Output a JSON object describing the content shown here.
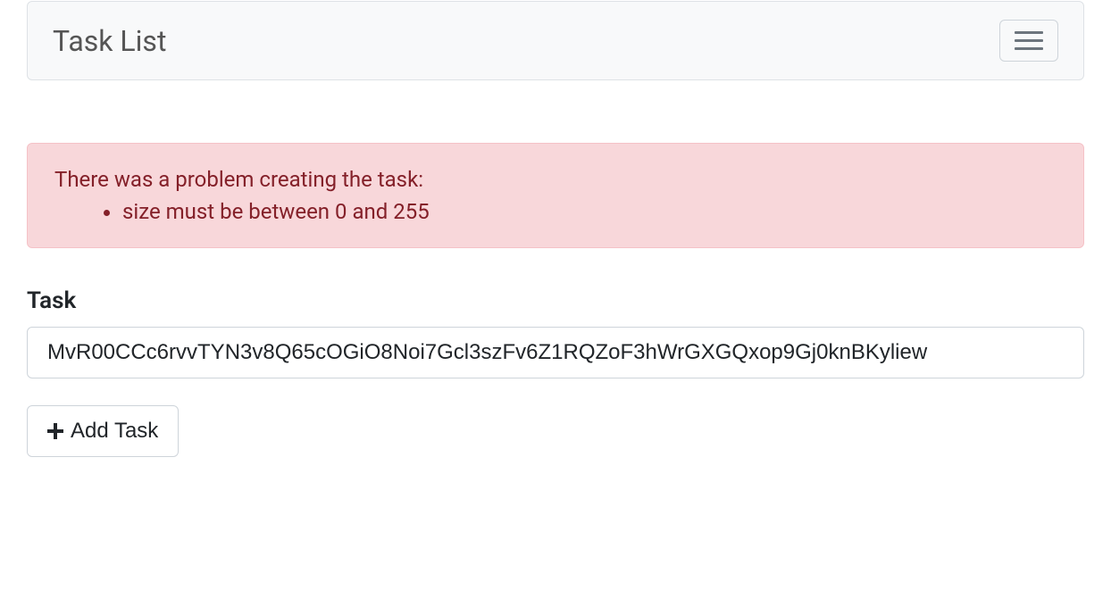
{
  "navbar": {
    "brand": "Task List"
  },
  "alert": {
    "heading": "There was a problem creating the task:",
    "errors": [
      "size must be between 0 and 255"
    ]
  },
  "form": {
    "task_label": "Task",
    "task_value": "MvR00CCc6rvvTYN3v8Q65cOGiO8Noi7Gcl3szFv6Z1RQZoF3hWrGXGQxop9Gj0knBKyliew",
    "add_button_label": " Add Task"
  }
}
